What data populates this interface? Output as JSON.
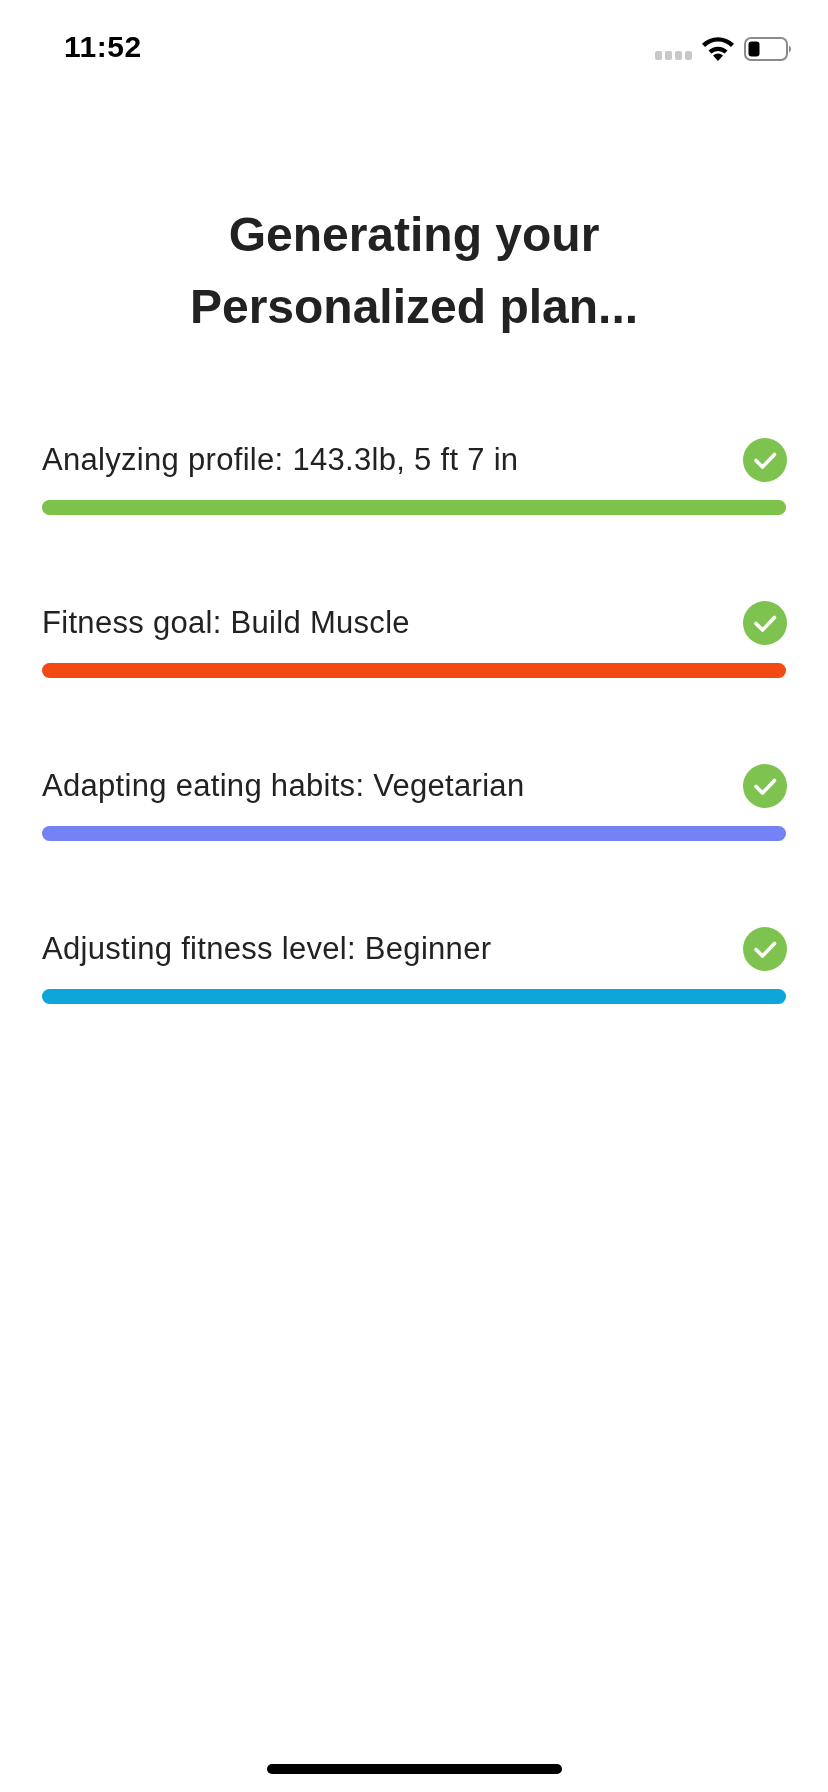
{
  "status_bar": {
    "time": "11:52"
  },
  "title": "Generating your Personalized plan...",
  "steps": [
    {
      "label": "Analyzing profile: 143.3lb, 5 ft 7 in",
      "completed": true,
      "level": 1,
      "color": "#7dc24b"
    },
    {
      "label": "Fitness goal: Build Muscle",
      "completed": true,
      "level": 1,
      "color": "#f24a12"
    },
    {
      "label": "Adapting eating habits: Vegetarian",
      "completed": true,
      "level": 1,
      "color": "#7383f5"
    },
    {
      "label": "Adjusting fitness level: Beginner",
      "completed": true,
      "level": 1,
      "color": "#0ea5d8"
    }
  ]
}
